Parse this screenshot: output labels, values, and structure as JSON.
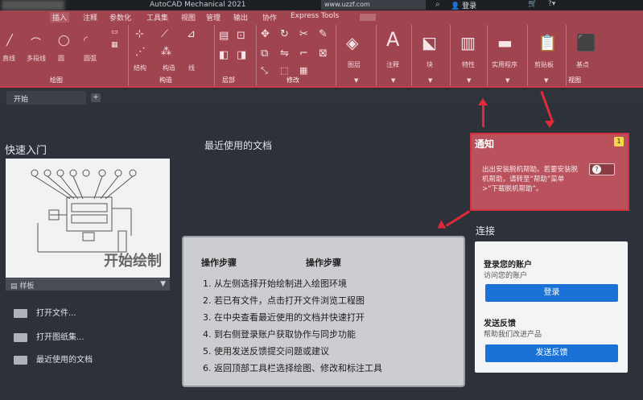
{
  "titlebar": {
    "app_title": "AutoCAD Mechanical 2021",
    "url": "www.uzzf.com",
    "login": "登录"
  },
  "ribbon": {
    "tabs": [
      "插入",
      "注释",
      "参数化",
      "工具集",
      "视图",
      "管理",
      "输出",
      "协作",
      "Express Tools"
    ],
    "panels": {
      "draw": {
        "label": "绘图",
        "tools": [
          "直线",
          "多段线",
          "圆",
          "圆弧"
        ]
      },
      "modify": {
        "label": "修改"
      },
      "build": {
        "label": "构造",
        "tools": [
          "结构",
          "构造",
          "线"
        ]
      },
      "layer": {
        "label": "层部"
      },
      "view": {
        "label": "视图"
      }
    },
    "big_tools": [
      "图层",
      "注释",
      "块",
      "特性",
      "实用程序",
      "剪贴板",
      "基点"
    ]
  },
  "docbar": {
    "tab_label": "开始",
    "plus": "+"
  },
  "quickstart": {
    "title": "快速入门",
    "card_label": "开始绘制",
    "template_label": "样板",
    "items": [
      "打开文件...",
      "打开图纸集...",
      "最近使用的文档"
    ]
  },
  "recent": {
    "title": "最近使用的文档"
  },
  "steps": {
    "heading_left": "操作步骤",
    "heading_right": "操作步骤",
    "items": [
      "1. 从左侧选择开始绘制进入绘图环境",
      "2. 若已有文件，点击打开文件浏览工程图",
      "3. 在中央查看最近使用的文档并快速打开",
      "4. 到右侧登录账户获取协作与同步功能",
      "5. 使用发送反馈提交问题或建议",
      "6. 返回顶部工具栏选择绘图、修改和标注工具"
    ]
  },
  "notice": {
    "title": "通知",
    "badge": "1",
    "text": "出出安装脱机帮助。若要安装脱机帮助，请转至“帮助”菜单 >“下载脱机帮助”。"
  },
  "connect": {
    "title": "连接",
    "account_heading": "登录您的账户",
    "account_sub": "访问您的账户",
    "login_button": "登录",
    "feedback_heading": "发送反馈",
    "feedback_sub": "帮助我们改进产品",
    "feedback_button": "发送反馈"
  }
}
